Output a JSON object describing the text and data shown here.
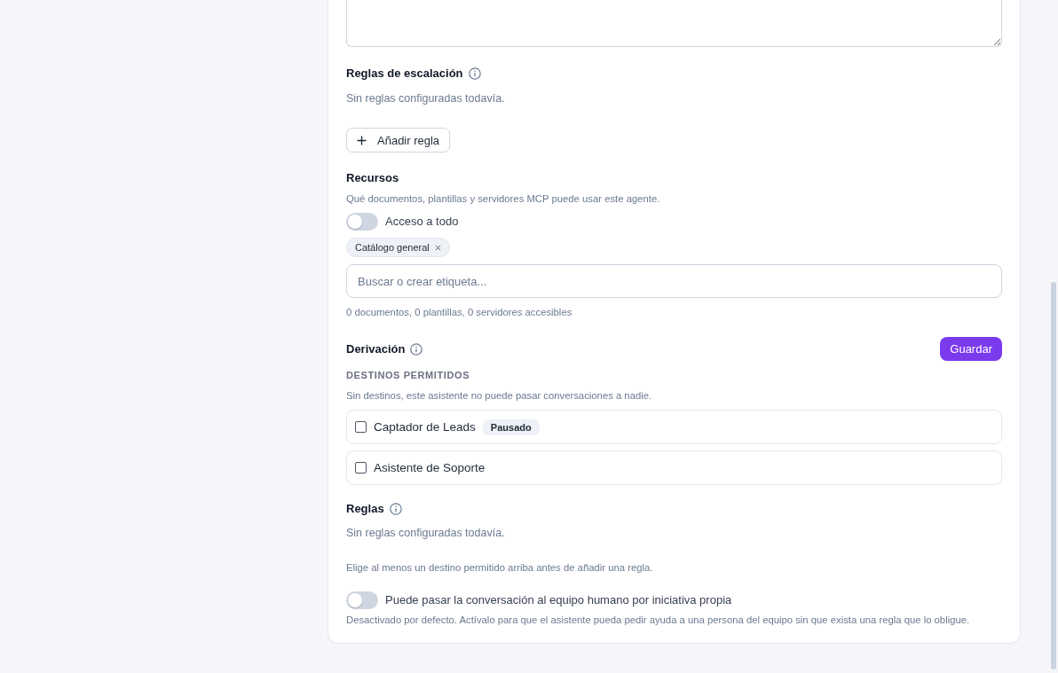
{
  "escalation": {
    "title": "Reglas de escalación",
    "empty_text": "Sin reglas configuradas todavía.",
    "add_button": "Añadir regla"
  },
  "resources": {
    "title": "Recursos",
    "description": "Qué documentos, plantillas y servidores MCP puede usar este agente.",
    "access_all": {
      "label": "Acceso a todo",
      "on": false
    },
    "tags": [
      {
        "label": "Catálogo general"
      }
    ],
    "search": {
      "placeholder": "Buscar o crear etiqueta..."
    },
    "summary": "0 documentos, 0 plantillas, 0 servidores accesibles"
  },
  "handoff": {
    "title": "Derivación",
    "save_button": "Guardar",
    "destinations_label": "DESTINOS PERMITIDOS",
    "destinations_hint": "Sin destinos, este asistente no puede pasar conversaciones a nadie.",
    "destinations": [
      {
        "name": "Captador de Leads",
        "checked": false,
        "badge": "Pausado"
      },
      {
        "name": "Asistente de Soporte",
        "checked": false
      }
    ],
    "rules": {
      "title": "Reglas",
      "empty_text": "Sin reglas configuradas todavía.",
      "hint": "Elige al menos un destino permitido arriba antes de añadir una regla."
    },
    "human_handoff": {
      "label": "Puede pasar la conversación al equipo humano por iniciativa propia",
      "on": false,
      "description": "Desactivado por defecto. Actívalo para que el asistente pueda pedir ayuda a una persona del equipo sin que exista una regla que lo obligue."
    }
  }
}
